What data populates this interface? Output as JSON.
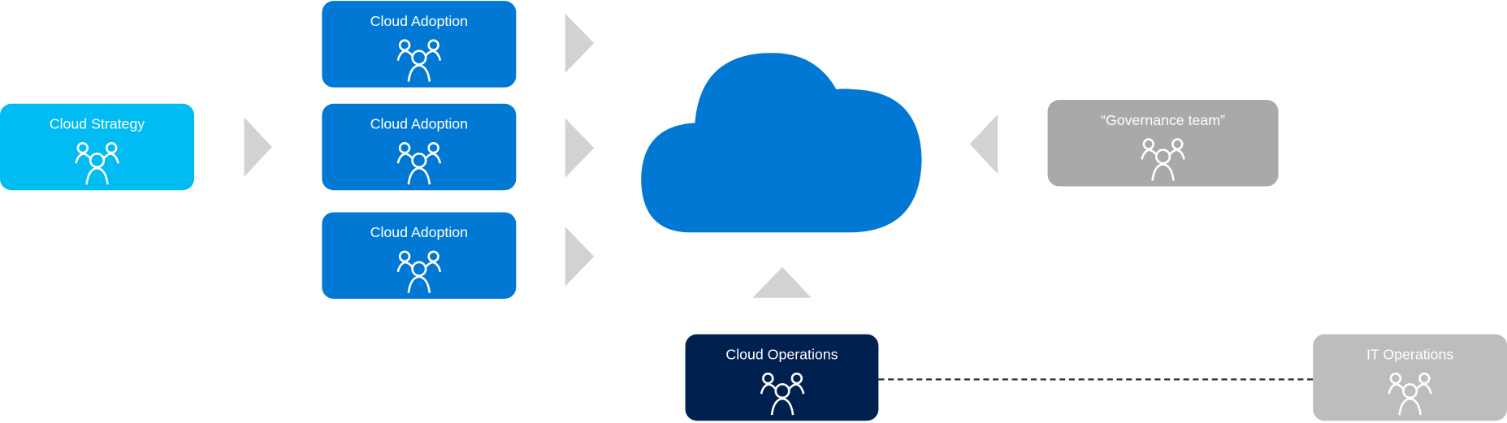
{
  "colors": {
    "strategy": "#00BCF2",
    "adoption": "#0078D4",
    "cloud": "#0078D4",
    "governance": "#A9A9A9",
    "operations": "#002050",
    "it_operations": "#BDBDBD",
    "arrow": "#D2D2D2"
  },
  "nodes": {
    "strategy": {
      "label": "Cloud Strategy",
      "icon": "people-group-icon"
    },
    "adoption": [
      {
        "label": "Cloud Adoption",
        "icon": "people-group-icon"
      },
      {
        "label": "Cloud Adoption",
        "icon": "people-group-icon"
      },
      {
        "label": "Cloud Adoption",
        "icon": "people-group-icon"
      }
    ],
    "governance": {
      "label": "“Governance team”",
      "icon": "people-group-icon"
    },
    "operations": {
      "label": "Cloud Operations",
      "icon": "people-group-icon"
    },
    "it_operations": {
      "label": "IT Operations",
      "icon": "people-group-icon"
    }
  },
  "center": {
    "icon": "cloud-icon"
  },
  "connectors": {
    "operations_to_it": "dashed"
  }
}
